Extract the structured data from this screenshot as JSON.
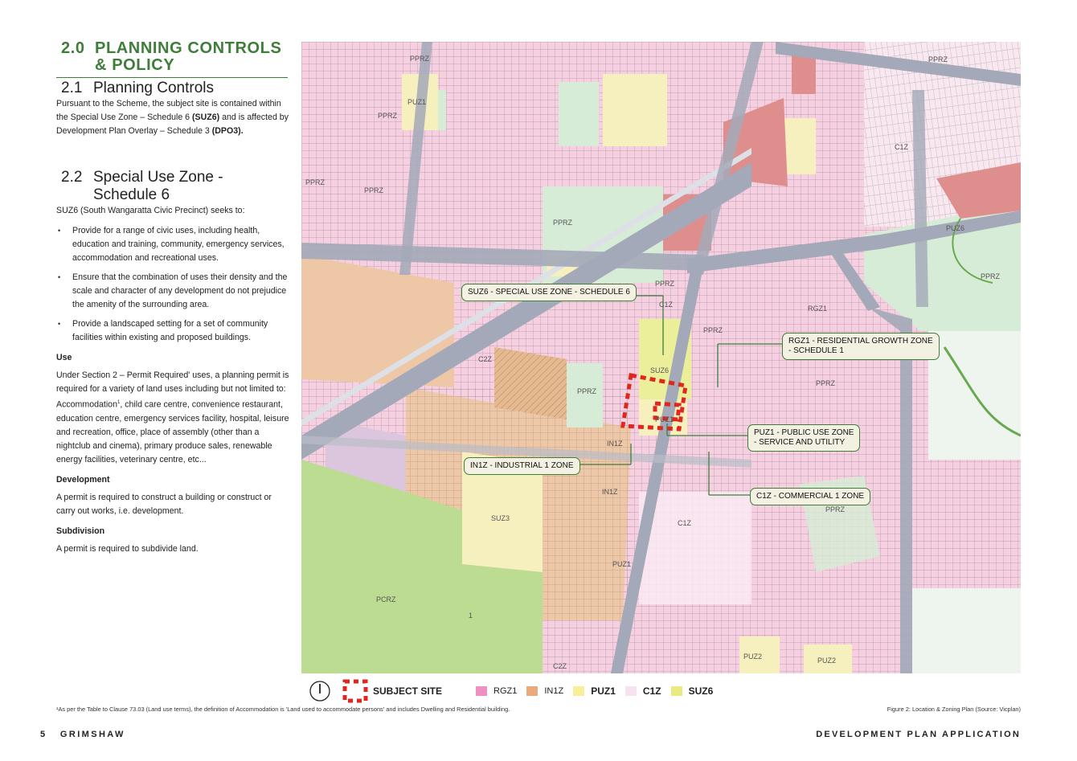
{
  "section": {
    "number": "2.0",
    "title_line1": "PLANNING CONTROLS",
    "title_line2": "& POLICY"
  },
  "sub1": {
    "number": "2.1",
    "title": "Planning Controls"
  },
  "para1": {
    "a": "Pursuant to the Scheme, the subject site is contained within the Special Use Zone – Schedule 6 ",
    "b": "(SUZ6)",
    "c": " and is affected by Development Plan Overlay – Schedule 3 ",
    "d": "(DPO3)."
  },
  "sub2": {
    "number": "2.2",
    "title_line1": "Special Use Zone -",
    "title_line2": "Schedule 6"
  },
  "intro": "SUZ6 (South Wangaratta Civic Precinct) seeks to:",
  "bullets": [
    "Provide for a range of civic uses, including health, education and training, community, emergency services, accommodation and recreational uses.",
    "Ensure that the combination of uses their density and the scale and character of any development do not prejudice the amenity of the surrounding area.",
    "Provide a landscaped setting for a set of community facilities within existing and proposed buildings."
  ],
  "use": {
    "heading": "Use",
    "text_a": "Under Section 2 – Permit Required' uses, a planning permit is required for a variety of land uses including but not limited to: Accommodation",
    "sup": "1",
    "text_b": ", child care centre, convenience restaurant, education centre, emergency services facility, hospital, leisure and recreation, office, place of assembly (other than a nightclub and cinema), primary produce sales, renewable energy facilities, veterinary centre, etc..."
  },
  "development": {
    "heading": "Development",
    "text": "A permit is required to construct a building or construct or carry out works, i.e. development."
  },
  "subdivision": {
    "heading": "Subdivision",
    "text": "A permit is required to subdivide land."
  },
  "map": {
    "callouts": {
      "suz6": "SUZ6 - SPECIAL USE ZONE - SCHEDULE 6",
      "rgz1_a": "RGZ1 - RESIDENTIAL GROWTH ZONE",
      "rgz1_b": "- SCHEDULE 1",
      "puz1_a": "PUZ1 - PUBLIC USE ZONE",
      "puz1_b": "- SERVICE AND UTILITY",
      "in1z": "IN1Z - INDUSTRIAL 1 ZONE",
      "c1z": "C1Z - COMMERCIAL 1 ZONE"
    },
    "labels": [
      "PPRZ",
      "PUZ1",
      "PPRZ",
      "PPRZ",
      "PPRZ",
      "PPRZ",
      "C1Z",
      "PPRZ",
      "PPRZ",
      "SUZ6",
      "PUZ1",
      "PPRZ",
      "IN1Z",
      "C2Z",
      "SUZ3",
      "PCRZ",
      "1",
      "IN1Z",
      "C1Z",
      "PUZ1",
      "PUZ2",
      "PUZ2",
      "C2Z",
      "PPRZ",
      "RGZ1",
      "PPRZ",
      "PPRZ",
      "C1Z",
      "PUZ6",
      "PPRZ"
    ],
    "colors": {
      "rgz1": "#f6cfe0",
      "in1z": "#eec7a6",
      "puz1": "#f5f0bd",
      "c1z": "#f9eaf2",
      "suz6": "#ecef9a",
      "pprz": "#d7ecd6",
      "pcrz": "#bcdc91",
      "road": "#a3a9b8",
      "gz": "#df8e8e"
    }
  },
  "legend": {
    "items": [
      {
        "label": "SUBJECT SITE",
        "swatch": "dashed-red"
      },
      {
        "label": "RGZ1",
        "color": "#f08fc2"
      },
      {
        "label": "IN1Z",
        "color": "#e9aa7c"
      },
      {
        "label": "PUZ1",
        "color": "#f7ef99"
      },
      {
        "label": "C1Z",
        "color": "#f6e3ef"
      },
      {
        "label": "SUZ6",
        "color": "#e9ea7f"
      }
    ]
  },
  "footnote": "¹As per the Table to Clause 73.03 (Land use terms), the definition of Accommodation is 'Land used to accommodate persons' and includes Dwelling and Residential building.",
  "caption": "Figure 2: Location & Zoning Plan (Source: Vicplan)",
  "footer": {
    "page": "5",
    "brand": "GRIMSHAW",
    "doc": "DEVELOPMENT PLAN APPLICATION"
  }
}
